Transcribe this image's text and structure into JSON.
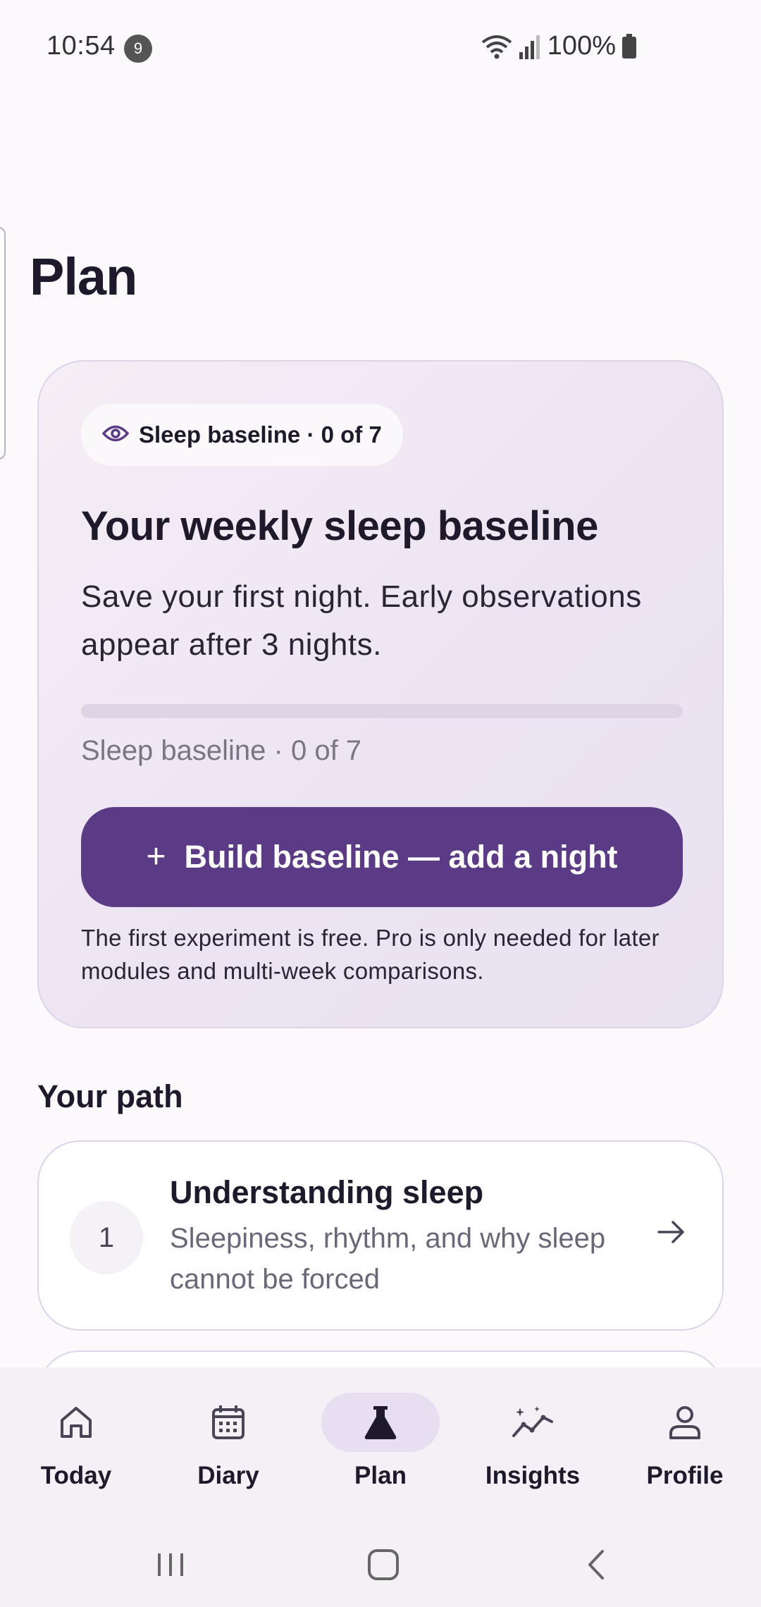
{
  "status_bar": {
    "time": "10:54",
    "notification_count": "9",
    "battery": "100%"
  },
  "page": {
    "title": "Plan"
  },
  "baseline_card": {
    "chip_label": "Sleep baseline · 0 of 7",
    "title": "Your weekly sleep baseline",
    "description": "Save your first night. Early observations appear after 3 nights.",
    "progress_fraction": 0,
    "progress_label": "Sleep baseline · 0 of 7",
    "cta_plus": "+",
    "cta_label": "Build baseline — add a night",
    "note": "The first experiment is free. Pro is only needed for later modules and multi-week comparisons.",
    "accent_color": "#5b3a86"
  },
  "path": {
    "section_title": "Your path",
    "modules": [
      {
        "number": "1",
        "title": "Understanding sleep",
        "description": "Sleepiness, rhythm, and why sleep cannot be forced"
      }
    ]
  },
  "bottom_nav": {
    "items": [
      {
        "label": "Today",
        "icon": "home-icon",
        "active": false
      },
      {
        "label": "Diary",
        "icon": "calendar-icon",
        "active": false
      },
      {
        "label": "Plan",
        "icon": "flask-icon",
        "active": true
      },
      {
        "label": "Insights",
        "icon": "sparkline-icon",
        "active": false
      },
      {
        "label": "Profile",
        "icon": "person-icon",
        "active": false
      }
    ]
  },
  "system_nav": {
    "buttons": [
      "recents-icon",
      "home-button-icon",
      "back-icon"
    ]
  }
}
